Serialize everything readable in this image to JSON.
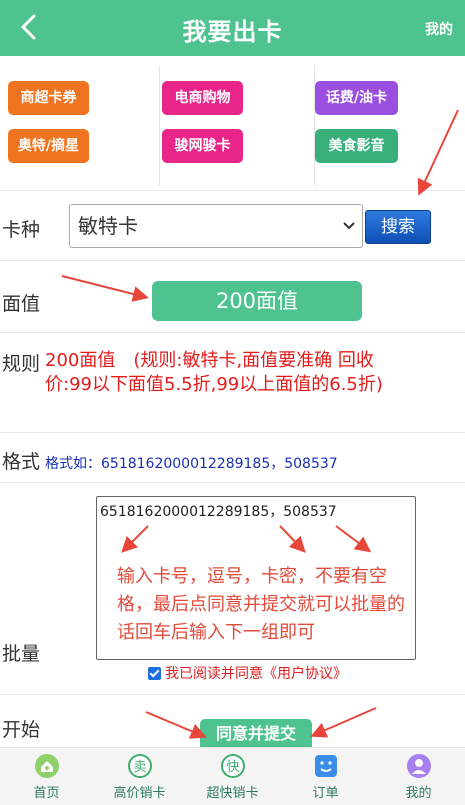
{
  "header": {
    "title": "我要出卡",
    "mine": "我的"
  },
  "categories": [
    {
      "label": "商超卡券",
      "color": "#f0731f"
    },
    {
      "label": "奥特/摘星",
      "color": "#f0731f"
    },
    {
      "label": "电商购物",
      "color": "#e8268a"
    },
    {
      "label": "骏网骏卡",
      "color": "#e8268a"
    },
    {
      "label": "话费/油卡",
      "color": "#9b4fe0"
    },
    {
      "label": "美食影音",
      "color": "#39b07c"
    }
  ],
  "form": {
    "card_type_label": "卡种",
    "card_type_value": "敏特卡",
    "search_label": "搜索",
    "face_label": "面值",
    "face_value": "200面值",
    "rule_label": "规则",
    "rule_text": "200面值　(规则:敏特卡,面值要准确 回收价:99以下面值5.5折,99以上面值的6.5折)",
    "format_label": "格式",
    "format_text": "格式如：6518162000012289185，508537",
    "batch_label": "批量",
    "batch_value": "6518162000012289185，508537",
    "batch_hint": "输入卡号，逗号，卡密，不要有空格，最后点同意并提交就可以批量的话回车后输入下一组即可",
    "agree_text": "我已阅读并同意《用户协议》",
    "start_label": "开始",
    "submit_label": "同意并提交"
  },
  "tabbar": [
    {
      "label": "首页",
      "icon": "home-icon"
    },
    {
      "label": "高价销卡",
      "icon": "sell-icon"
    },
    {
      "label": "超快销卡",
      "icon": "fast-icon"
    },
    {
      "label": "订单",
      "icon": "order-icon"
    },
    {
      "label": "我的",
      "icon": "user-icon"
    }
  ],
  "colors": {
    "brand": "#4ec38f",
    "rule_red": "#e41b1b",
    "arrow_red": "#e8463a"
  }
}
